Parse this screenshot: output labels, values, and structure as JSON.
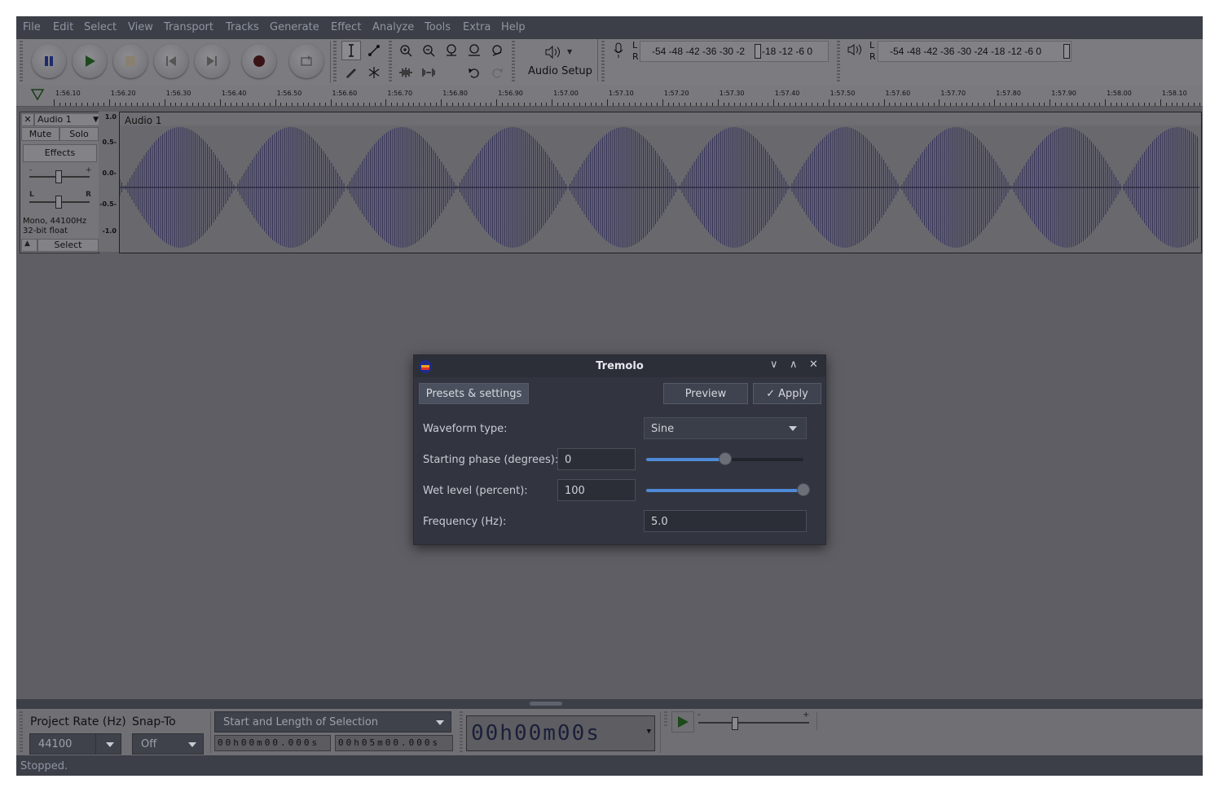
{
  "menu": [
    "File",
    "Edit",
    "Select",
    "View",
    "Transport",
    "Tracks",
    "Generate",
    "Effect",
    "Analyze",
    "Tools",
    "Extra",
    "Help"
  ],
  "toolbar": {
    "audio_setup_label": "Audio Setup",
    "record_meter_scale": "-54 -48 -42 -36 -30 -2",
    "record_meter_scale_end": "-18 -12  -6   0",
    "play_meter_scale": "-54 -48 -42 -36 -30 -24 -18 -12  -6   0",
    "meter_l": "L",
    "meter_r": "R"
  },
  "ruler_ticks": [
    "1:56.10",
    "1:56.20",
    "1:56.30",
    "1:56.40",
    "1:56.50",
    "1:56.60",
    "1:56.70",
    "1:56.80",
    "1:56.90",
    "1:57.00",
    "1:57.10",
    "1:57.20",
    "1:57.30",
    "1:57.40",
    "1:57.50",
    "1:57.60",
    "1:57.70",
    "1:57.80",
    "1:57.90",
    "1:58.00",
    "1:58.10"
  ],
  "track": {
    "name": "Audio 1",
    "mute": "Mute",
    "solo": "Solo",
    "effects": "Effects",
    "gain_minus": "-",
    "gain_plus": "+",
    "pan_l": "L",
    "pan_r": "R",
    "format_line1": "Mono, 44100Hz",
    "format_line2": "32-bit float",
    "select": "Select",
    "clip_name": "Audio 1",
    "vruler": [
      "1.0",
      "0.5-",
      "0.0-",
      "-0.5-",
      "-1.0"
    ]
  },
  "dialog": {
    "title": "Tremolo",
    "presets_button": "Presets & settings",
    "preview_button": "Preview",
    "apply_button": "Apply",
    "waveform_label": "Waveform type:",
    "waveform_value": "Sine",
    "phase_label": "Starting phase (degrees):",
    "phase_value": "0",
    "phase_slider_fraction": 0.5,
    "wet_label": "Wet level (percent):",
    "wet_value": "100",
    "wet_slider_fraction": 1.0,
    "freq_label": "Frequency (Hz):",
    "freq_value": "5.0"
  },
  "selection_bar": {
    "project_rate_label": "Project Rate (Hz)",
    "project_rate_value": "44100",
    "snap_label": "Snap-To",
    "snap_value": "Off",
    "selection_mode": "Start and Length of Selection",
    "start_time": "00h00m00.000s",
    "length_time": "00h05m00.000s",
    "big_time": "00h00m00s",
    "speed_minus": "-",
    "speed_plus": "+"
  },
  "status": "Stopped."
}
